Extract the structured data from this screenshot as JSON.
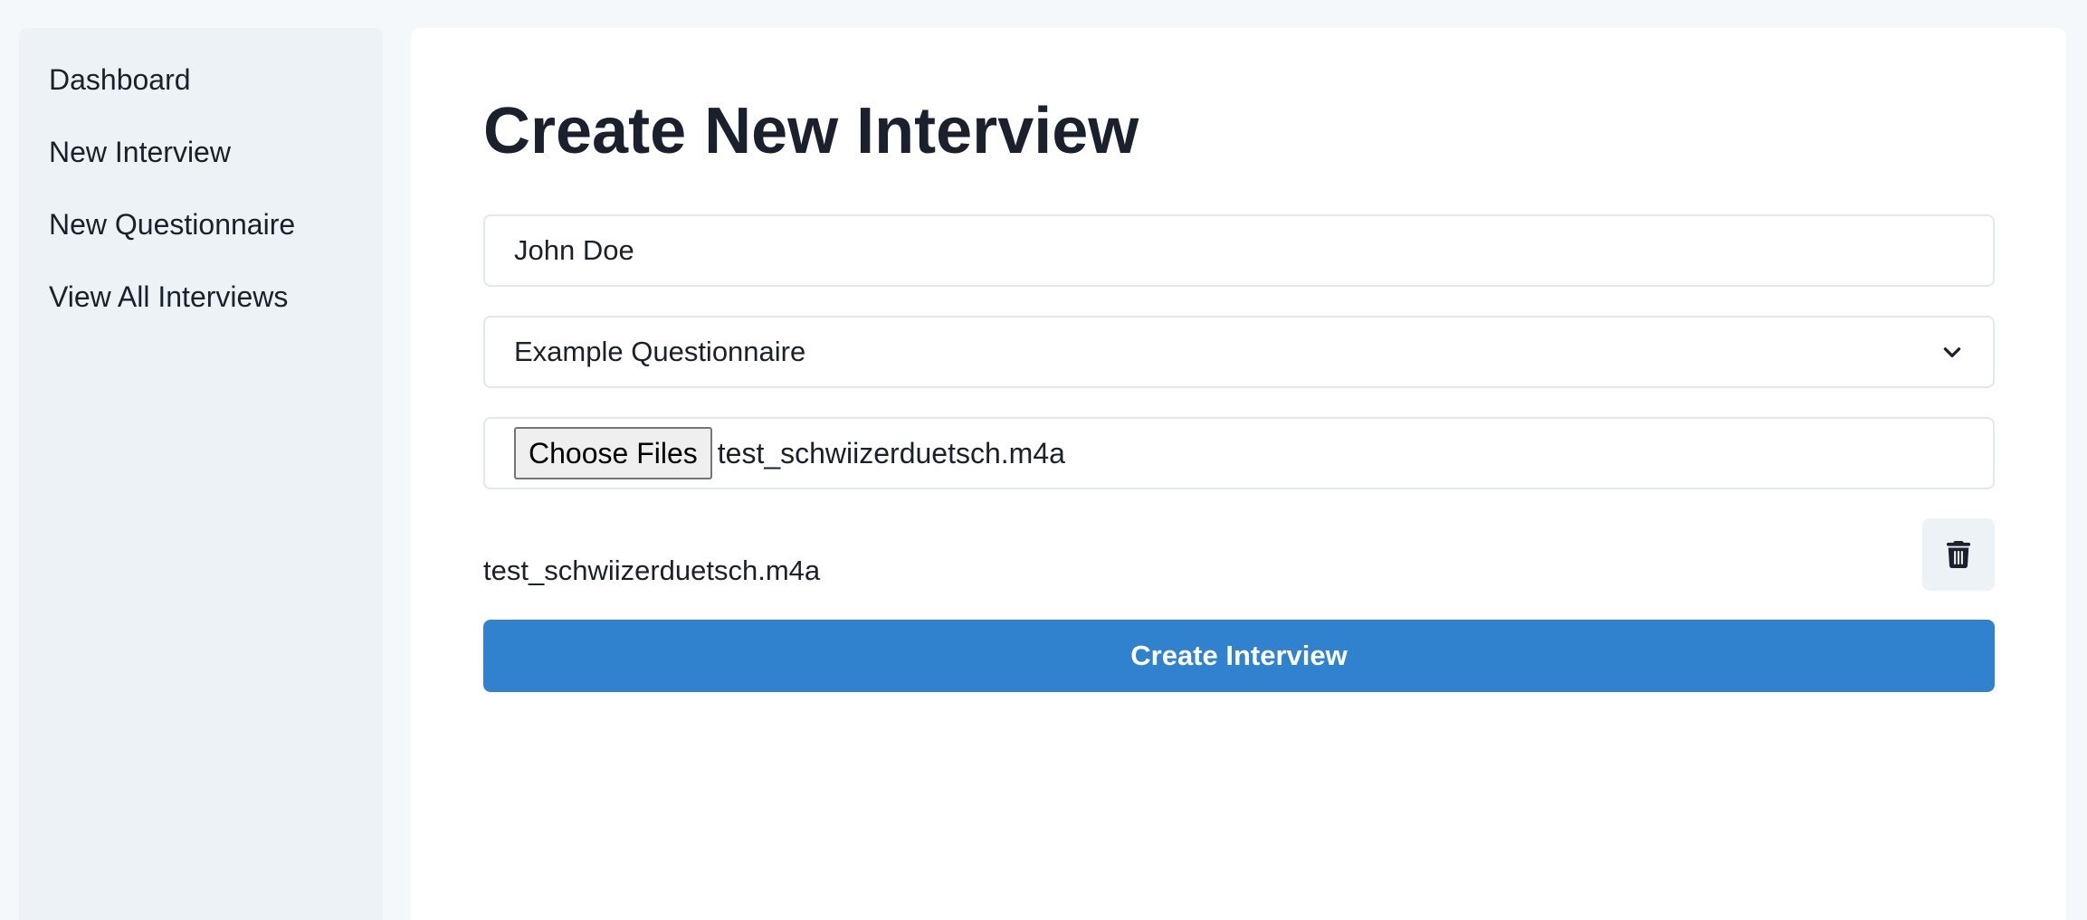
{
  "sidebar": {
    "items": [
      {
        "label": "Dashboard"
      },
      {
        "label": "New Interview"
      },
      {
        "label": "New Questionnaire"
      },
      {
        "label": "View All Interviews"
      }
    ]
  },
  "form": {
    "title": "Create New Interview",
    "name_value": "John Doe",
    "questionnaire_selected": "Example Questionnaire",
    "file_button_label": "Choose Files",
    "file_chosen_text": "test_schwiizerduetsch.m4a",
    "uploaded_files": [
      {
        "name": "test_schwiizerduetsch.m4a"
      }
    ],
    "submit_label": "Create Interview"
  },
  "icons": {
    "select_arrow": "chevron-down-icon",
    "delete": "trash-icon"
  },
  "colors": {
    "primary": "#3182ce",
    "sidebar_bg": "#edf2f7",
    "page_bg": "#f5f8fb",
    "text": "#1a202c"
  }
}
